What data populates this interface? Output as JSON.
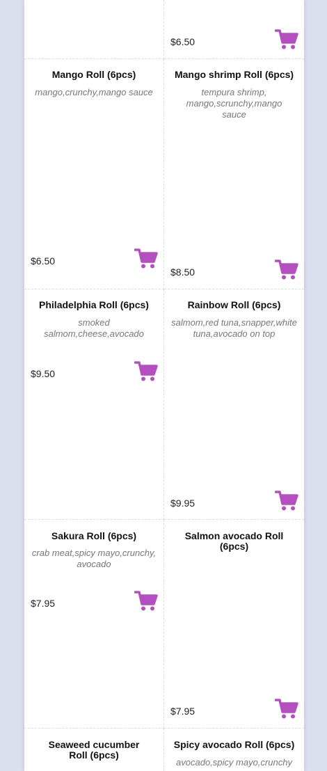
{
  "colors": {
    "accent": "#b44fc0",
    "background": "#dbe0ef"
  },
  "cart_icon": "shopping-cart-icon",
  "items": [
    {
      "price": "$6.50"
    },
    {
      "name": "Mango Roll (6pcs)",
      "desc": "mango,crunchy,mango sauce",
      "price": "$6.50"
    },
    {
      "name": "Mango shrimp Roll (6pcs)",
      "desc": "tempura shrimp, mango,scrunchy,mango sauce",
      "price": "$8.50"
    },
    {
      "name": "Philadelphia Roll (6pcs)",
      "desc": "smoked salmom,cheese,avocado",
      "price": "$9.50"
    },
    {
      "name": "Rainbow Roll (6pcs)",
      "desc": "salmom,red tuna,snapper,white tuna,avocado on top",
      "price": "$9.95"
    },
    {
      "name": "Sakura Roll (6pcs)",
      "desc": "crab meat,spicy mayo,crunchy, avocado",
      "price": "$7.95"
    },
    {
      "name": "Salmon avocado Roll (6pcs)",
      "price": "$7.95"
    },
    {
      "name": "Seaweed cucumber Roll (6pcs)"
    },
    {
      "name": "Spicy avocado Roll (6pcs)",
      "desc": "avocado,spicy mayo,crunchy"
    }
  ]
}
